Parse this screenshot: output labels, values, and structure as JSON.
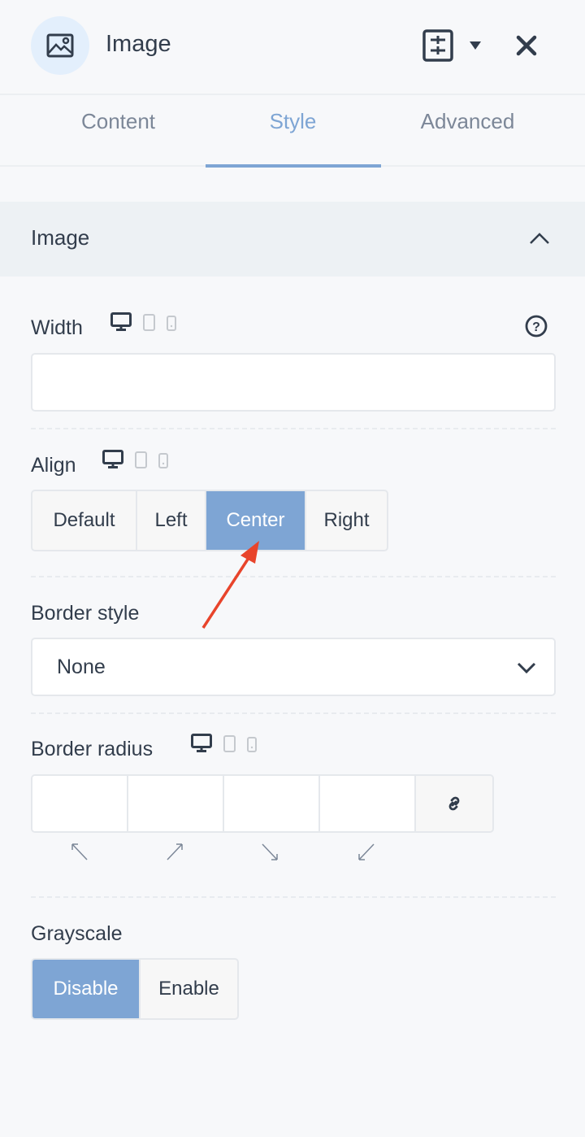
{
  "header": {
    "title": "Image",
    "icon": "image-icon",
    "actions": [
      "sliders-icon",
      "caret-down-icon",
      "close-icon"
    ]
  },
  "tabs": [
    {
      "label": "Content"
    },
    {
      "label": "Style",
      "active": true
    },
    {
      "label": "Advanced"
    }
  ],
  "section": {
    "title": "Image",
    "expanded": true
  },
  "width": {
    "label": "Width",
    "value": ""
  },
  "align": {
    "label": "Align",
    "options": [
      "Default",
      "Left",
      "Center",
      "Right"
    ],
    "selected": "Center"
  },
  "border_style": {
    "label": "Border style",
    "value": "None"
  },
  "border_radius": {
    "label": "Border radius",
    "values": [
      "",
      "",
      "",
      ""
    ],
    "linked": true
  },
  "grayscale": {
    "label": "Grayscale",
    "options": [
      "Disable",
      "Enable"
    ],
    "selected": "Disable"
  },
  "colors": {
    "accent": "#7ea5d4",
    "annotation_arrow": "#e8442b"
  }
}
